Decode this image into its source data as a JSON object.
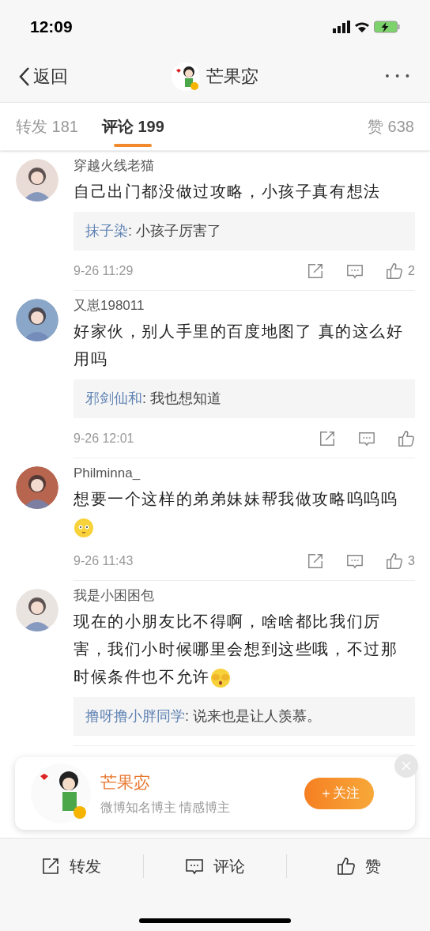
{
  "status_bar": {
    "time": "12:09"
  },
  "nav": {
    "back": "返回",
    "title": "芒果宓",
    "more": "• • •"
  },
  "tabs": [
    {
      "label": "转发 181",
      "selected": false
    },
    {
      "label": "评论 199",
      "selected": true
    }
  ],
  "likes_tab": "赞 638",
  "comments": [
    {
      "user": "穿越火线老猫",
      "text": "自己出门都没做过攻略，小孩子真有想法",
      "reply": {
        "user": "抹子染",
        "text": ": 小孩子厉害了"
      },
      "time": "9-26 11:29",
      "likes": "2"
    },
    {
      "user": "又崽198011",
      "text": "好家伙，别人手里的百度地图了 真的这么好用吗",
      "reply": {
        "user": "邪剑仙和",
        "text": ": 我也想知道"
      },
      "time": "9-26 12:01"
    },
    {
      "user": "Philminna_",
      "text": "想要一个这样的弟弟妹妹帮我做攻略呜呜呜",
      "emoji": {
        "kind": "flushed"
      },
      "time": "9-26 11:43",
      "likes": "3"
    },
    {
      "user": "我是小困困包",
      "text": "现在的小朋友比不得啊，啥啥都比我们厉害，我们小时候哪里会想到这些哦，不过那时候条件也不允许",
      "emoji": {
        "kind": "cover"
      },
      "reply": {
        "user": "撸呀撸小胖同学",
        "text": ": 说来也是让人羡慕。"
      }
    }
  ],
  "popup": {
    "name": "芒果宓",
    "desc": "微博知名博主 情感博主",
    "follow": "＋关注"
  },
  "bottom_bar": [
    "转发",
    "评论",
    "赞"
  ]
}
